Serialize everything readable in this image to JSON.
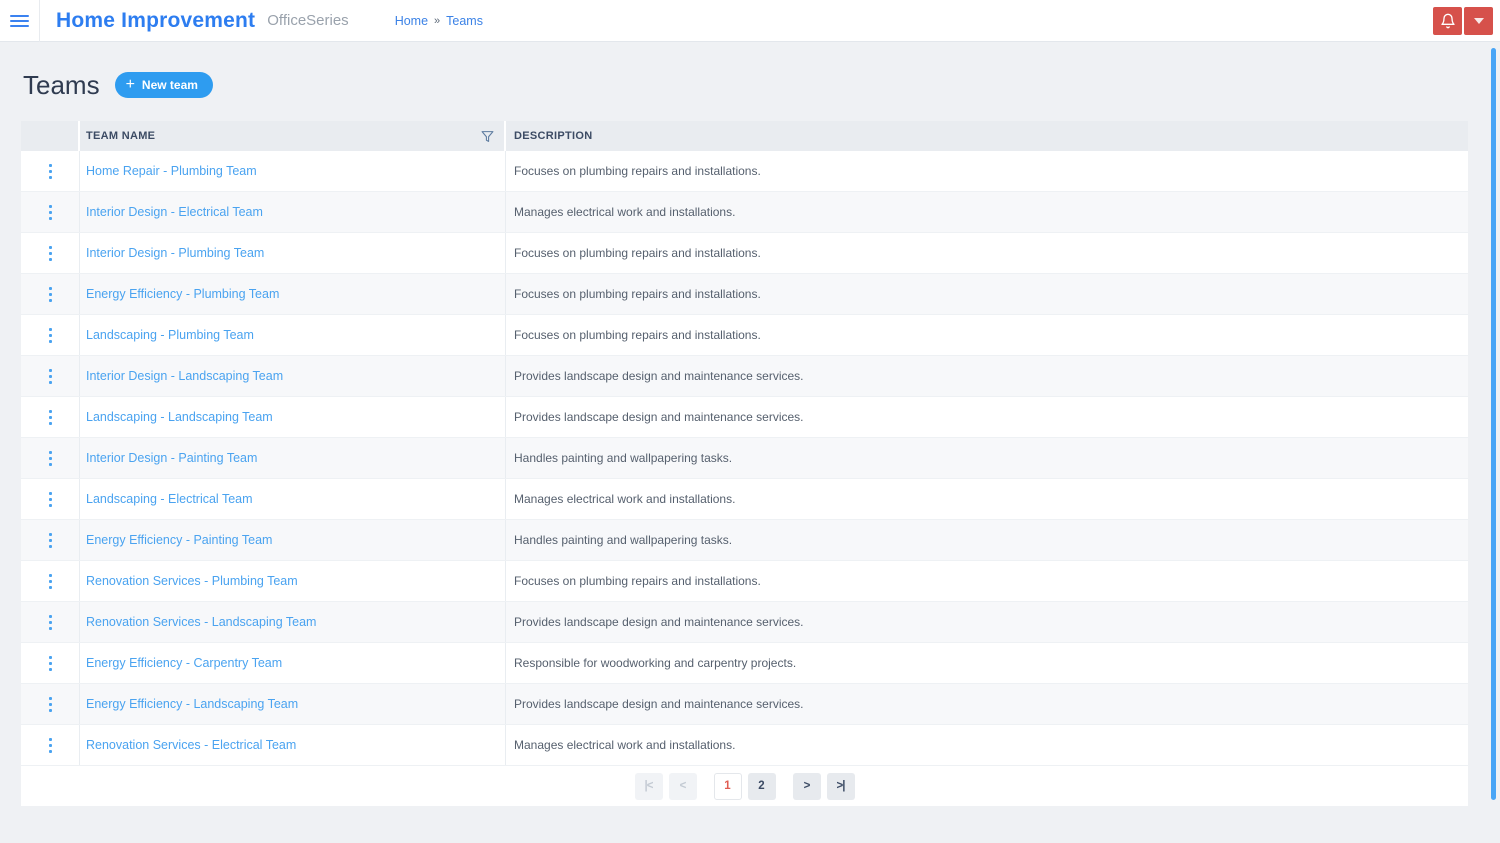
{
  "header": {
    "title": "Home Improvement",
    "subtitle": "OfficeSeries",
    "breadcrumb": {
      "home": "Home",
      "separator": "»",
      "current": "Teams"
    }
  },
  "page": {
    "title": "Teams",
    "new_team_plus": "+",
    "new_team_label": "New team"
  },
  "table": {
    "columns": {
      "team_name": "TEAM NAME",
      "description": "DESCRIPTION"
    },
    "rows": [
      {
        "name": "Home Repair - Plumbing Team",
        "description": "Focuses on plumbing repairs and installations."
      },
      {
        "name": "Interior Design - Electrical Team",
        "description": "Manages electrical work and installations."
      },
      {
        "name": "Interior Design - Plumbing Team",
        "description": "Focuses on plumbing repairs and installations."
      },
      {
        "name": "Energy Efficiency - Plumbing Team",
        "description": "Focuses on plumbing repairs and installations."
      },
      {
        "name": "Landscaping - Plumbing Team",
        "description": "Focuses on plumbing repairs and installations."
      },
      {
        "name": "Interior Design - Landscaping Team",
        "description": "Provides landscape design and maintenance services."
      },
      {
        "name": "Landscaping - Landscaping Team",
        "description": "Provides landscape design and maintenance services."
      },
      {
        "name": "Interior Design - Painting Team",
        "description": "Handles painting and wallpapering tasks."
      },
      {
        "name": "Landscaping - Electrical Team",
        "description": "Manages electrical work and installations."
      },
      {
        "name": "Energy Efficiency - Painting Team",
        "description": "Handles painting and wallpapering tasks."
      },
      {
        "name": "Renovation Services - Plumbing Team",
        "description": "Focuses on plumbing repairs and installations."
      },
      {
        "name": "Renovation Services - Landscaping Team",
        "description": "Provides landscape design and maintenance services."
      },
      {
        "name": "Energy Efficiency - Carpentry Team",
        "description": "Responsible for woodworking and carpentry projects."
      },
      {
        "name": "Energy Efficiency - Landscaping Team",
        "description": "Provides landscape design and maintenance services."
      },
      {
        "name": "Renovation Services - Electrical Team",
        "description": "Manages electrical work and installations."
      }
    ]
  },
  "pagination": {
    "first_label": "|<",
    "prev_label": "<",
    "pages": [
      "1",
      "2"
    ],
    "current_page": "1",
    "next_label": ">",
    "last_label": ">|"
  },
  "icons": {
    "menu": "hamburger-menu",
    "notifications": "bell",
    "account": "caret-down",
    "filter": "funnel",
    "row_menu": "kebab-dots"
  },
  "colors": {
    "brand_blue": "#2d7df0",
    "accent_blue": "#2e9cf0",
    "link_blue": "#4aa3f0",
    "alert_red": "#d6514b",
    "scrollbar_blue": "#49a5f6",
    "current_page_red": "#e05d52",
    "header_row_bg": "#e9ecf0",
    "alt_row_bg": "#f7f8fa"
  }
}
